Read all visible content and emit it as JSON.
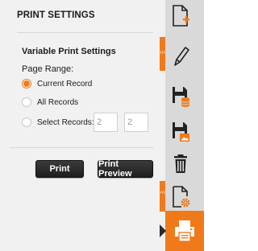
{
  "panel": {
    "title": "PRINT SETTINGS",
    "section_title": "Variable Print Settings",
    "page_range_label": "Page Range:"
  },
  "range_options": [
    {
      "label": "Current Record",
      "checked": true
    },
    {
      "label": "All Records",
      "checked": false
    },
    {
      "label": "Select Records:",
      "checked": false
    }
  ],
  "select_records": {
    "from": "2",
    "to": "2"
  },
  "buttons": {
    "print": "Print",
    "print_preview": "Print Preview"
  },
  "sidebar": {
    "tools": [
      {
        "name": "new-page-icon"
      },
      {
        "name": "pencil-icon"
      },
      {
        "name": "save-database-icon"
      },
      {
        "name": "save-image-icon"
      },
      {
        "name": "trash-icon"
      },
      {
        "name": "page-settings-icon"
      },
      {
        "name": "printer-icon",
        "active": true
      }
    ],
    "collapse_glyph": "‹‹‹"
  },
  "colors": {
    "accent": "#f07a1a",
    "panel_bg": "#f1f1f1",
    "sidebar_bg": "#d9d9d9",
    "button_bg": "#2a2a2a"
  }
}
